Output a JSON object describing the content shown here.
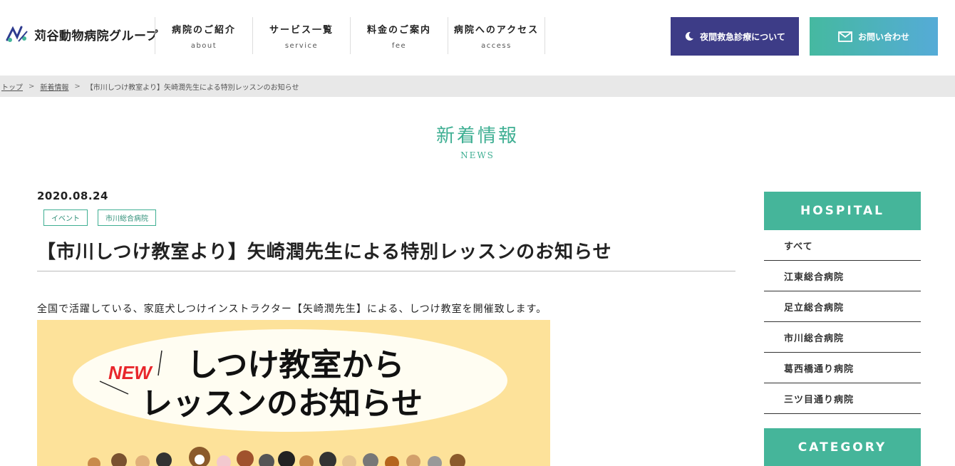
{
  "header": {
    "logo_text": "苅谷動物病院グループ",
    "nav": [
      {
        "jp": "病院のご紹介",
        "en": "about"
      },
      {
        "jp": "サービス一覧",
        "en": "service"
      },
      {
        "jp": "料金のご案内",
        "en": "fee"
      },
      {
        "jp": "病院へのアクセス",
        "en": "access"
      }
    ],
    "night_button": "夜間救急診療について",
    "contact_button": "お問い合わせ"
  },
  "breadcrumb": {
    "top": "トップ",
    "news": "新着情報",
    "sep": ">",
    "current": "【市川しつけ教室より】矢崎潤先生による特別レッスンのお知らせ"
  },
  "page_title": {
    "jp": "新着情報",
    "en": "NEWS"
  },
  "post": {
    "date": "2020.08.24",
    "tags": [
      "イベント",
      "市川総合病院"
    ],
    "title": "【市川しつけ教室より】矢崎潤先生による特別レッスンのお知らせ",
    "lead": "全国で活躍している、家庭犬しつけインストラクター【矢崎潤先生】による、しつけ教室を開催致します。",
    "banner": {
      "badge": "NEW",
      "line1": "しつけ教室から",
      "line2": "レッスンのお知らせ"
    }
  },
  "sidebar": {
    "hospital_heading": "HOSPITAL",
    "hospitals": [
      "すべて",
      "江東総合病院",
      "足立総合病院",
      "市川総合病院",
      "葛西橋通り病院",
      "三ツ目通り病院"
    ],
    "category_heading": "CATEGORY"
  },
  "colors": {
    "accent": "#45b59a",
    "night": "#3d3c87",
    "banner_bg": "#fde29a"
  }
}
